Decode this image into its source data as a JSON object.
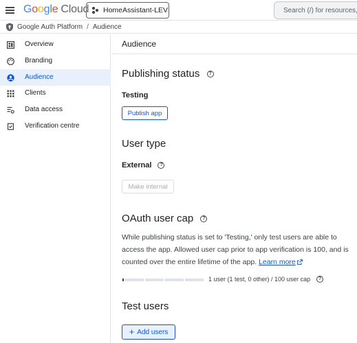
{
  "topbar": {
    "logo": {
      "google": "Google",
      "cloud": "Cloud"
    },
    "project": "HomeAssistant-LEV",
    "search_placeholder": "Search (/) for resources, docs"
  },
  "breadcrumb": {
    "items": [
      "Google Auth Platform",
      "Audience"
    ],
    "separator": "/"
  },
  "sidebar": {
    "items": [
      {
        "label": "Overview",
        "icon": "dashboard-icon"
      },
      {
        "label": "Branding",
        "icon": "palette-icon"
      },
      {
        "label": "Audience",
        "icon": "person-circle-icon",
        "active": true
      },
      {
        "label": "Clients",
        "icon": "grid-icon"
      },
      {
        "label": "Data access",
        "icon": "list-settings-icon"
      },
      {
        "label": "Verification centre",
        "icon": "verified-doc-icon"
      }
    ]
  },
  "main": {
    "header": "Audience",
    "publishing": {
      "title": "Publishing status",
      "status": "Testing",
      "button": "Publish app"
    },
    "user_type": {
      "title": "User type",
      "value": "External",
      "button": "Make internal"
    },
    "cap": {
      "title": "OAuth user cap",
      "description": "While publishing status is set to 'Testing,' only test users are able to access the app. Allowed user cap prior to app verification is 100, and is counted over the entire lifetime of the app.",
      "learn_more": "Learn more",
      "usage_text": "1 user (1 test, 0 other) / 100 user cap",
      "usage_fraction": 0.01
    },
    "test_users": {
      "title": "Test users",
      "button": "Add users"
    }
  },
  "colors": {
    "accent": "#0b57d0",
    "active_bg": "#e8f0fe",
    "border": "#e3e3e3"
  }
}
